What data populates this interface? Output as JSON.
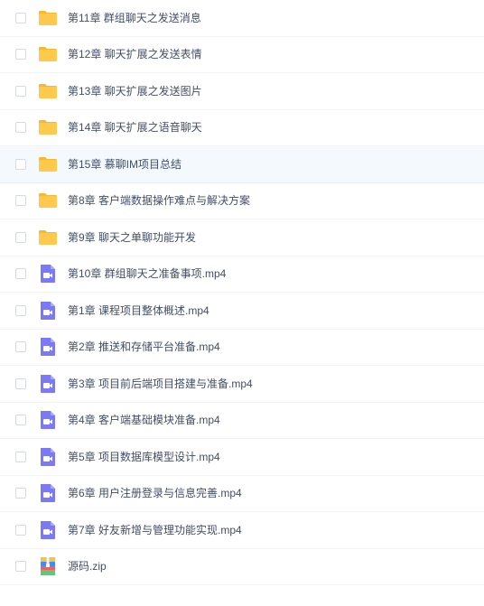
{
  "file_list": {
    "items": [
      {
        "name": "第11章 群组聊天之发送消息",
        "type": "folder"
      },
      {
        "name": "第12章 聊天扩展之发送表情",
        "type": "folder"
      },
      {
        "name": "第13章 聊天扩展之发送图片",
        "type": "folder"
      },
      {
        "name": "第14章 聊天扩展之语音聊天",
        "type": "folder"
      },
      {
        "name": "第15章 慕聊IM项目总结",
        "type": "folder",
        "hovered": true
      },
      {
        "name": "第8章 客户端数据操作难点与解决方案",
        "type": "folder"
      },
      {
        "name": "第9章 聊天之单聊功能开发",
        "type": "folder"
      },
      {
        "name": "第10章 群组聊天之准备事项.mp4",
        "type": "video"
      },
      {
        "name": "第1章 课程项目整体概述.mp4",
        "type": "video"
      },
      {
        "name": "第2章 推送和存储平台准备.mp4",
        "type": "video"
      },
      {
        "name": "第3章 项目前后端项目搭建与准备.mp4",
        "type": "video"
      },
      {
        "name": "第4章 客户端基础模块准备.mp4",
        "type": "video"
      },
      {
        "name": "第5章 项目数据库模型设计.mp4",
        "type": "video"
      },
      {
        "name": "第6章 用户注册登录与信息完善.mp4",
        "type": "video"
      },
      {
        "name": "第7章 好友新增与管理功能实现.mp4",
        "type": "video"
      },
      {
        "name": "源码.zip",
        "type": "archive"
      }
    ]
  },
  "icons": {
    "folder": "folder-icon",
    "video": "video-file-icon",
    "archive": "zip-archive-icon"
  },
  "colors": {
    "folder": "#ffc94d",
    "folder_tab": "#f5b82e",
    "video": "#7b79f5",
    "hover_bg": "#f3f9fd",
    "text": "#424e67"
  }
}
